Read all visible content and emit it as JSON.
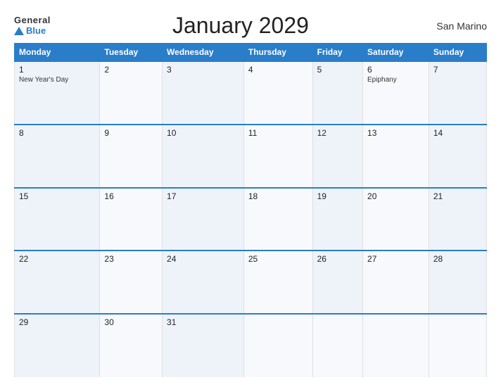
{
  "logo": {
    "general": "General",
    "blue": "Blue"
  },
  "header": {
    "title": "January 2029",
    "region": "San Marino"
  },
  "weekdays": [
    "Monday",
    "Tuesday",
    "Wednesday",
    "Thursday",
    "Friday",
    "Saturday",
    "Sunday"
  ],
  "weeks": [
    [
      {
        "day": "1",
        "holiday": "New Year's Day"
      },
      {
        "day": "2",
        "holiday": ""
      },
      {
        "day": "3",
        "holiday": ""
      },
      {
        "day": "4",
        "holiday": ""
      },
      {
        "day": "5",
        "holiday": ""
      },
      {
        "day": "6",
        "holiday": "Epiphany"
      },
      {
        "day": "7",
        "holiday": ""
      }
    ],
    [
      {
        "day": "8",
        "holiday": ""
      },
      {
        "day": "9",
        "holiday": ""
      },
      {
        "day": "10",
        "holiday": ""
      },
      {
        "day": "11",
        "holiday": ""
      },
      {
        "day": "12",
        "holiday": ""
      },
      {
        "day": "13",
        "holiday": ""
      },
      {
        "day": "14",
        "holiday": ""
      }
    ],
    [
      {
        "day": "15",
        "holiday": ""
      },
      {
        "day": "16",
        "holiday": ""
      },
      {
        "day": "17",
        "holiday": ""
      },
      {
        "day": "18",
        "holiday": ""
      },
      {
        "day": "19",
        "holiday": ""
      },
      {
        "day": "20",
        "holiday": ""
      },
      {
        "day": "21",
        "holiday": ""
      }
    ],
    [
      {
        "day": "22",
        "holiday": ""
      },
      {
        "day": "23",
        "holiday": ""
      },
      {
        "day": "24",
        "holiday": ""
      },
      {
        "day": "25",
        "holiday": ""
      },
      {
        "day": "26",
        "holiday": ""
      },
      {
        "day": "27",
        "holiday": ""
      },
      {
        "day": "28",
        "holiday": ""
      }
    ],
    [
      {
        "day": "29",
        "holiday": ""
      },
      {
        "day": "30",
        "holiday": ""
      },
      {
        "day": "31",
        "holiday": ""
      },
      {
        "day": "",
        "holiday": ""
      },
      {
        "day": "",
        "holiday": ""
      },
      {
        "day": "",
        "holiday": ""
      },
      {
        "day": "",
        "holiday": ""
      }
    ]
  ]
}
